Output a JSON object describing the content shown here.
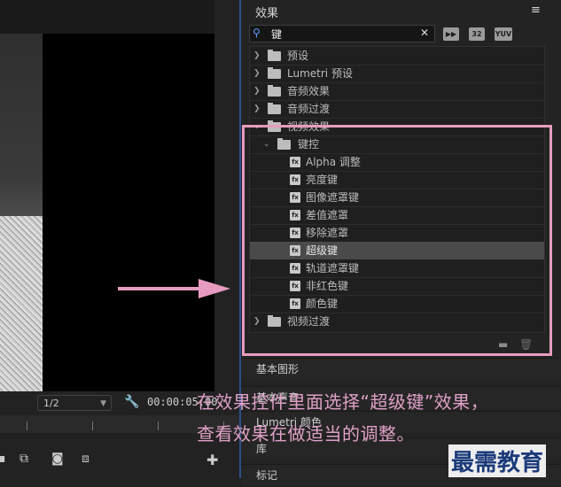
{
  "monitor": {
    "resolution": "1/2",
    "timecode": "00:00:05:00",
    "controls": [
      "step-back-icon",
      "insert-icon",
      "camera-icon",
      "compare-icon",
      "add-icon"
    ]
  },
  "effects_panel": {
    "title": "效果",
    "menu_icon": "hamburger-icon",
    "search_value": "键",
    "filter_buttons": [
      "accelerated-effects-icon",
      "32",
      "YUV"
    ],
    "tree": [
      {
        "label": "预设",
        "type": "folder",
        "level": 0,
        "expanded": false
      },
      {
        "label": "Lumetri 预设",
        "type": "folder",
        "level": 0,
        "expanded": false
      },
      {
        "label": "音频效果",
        "type": "folder",
        "level": 0,
        "expanded": false
      },
      {
        "label": "音频过渡",
        "type": "folder",
        "level": 0,
        "expanded": false
      },
      {
        "label": "视频效果",
        "type": "folder",
        "level": 0,
        "expanded": true
      },
      {
        "label": "键控",
        "type": "folder",
        "level": 1,
        "expanded": true
      },
      {
        "label": "Alpha 调整",
        "type": "effect",
        "level": 2
      },
      {
        "label": "亮度键",
        "type": "effect",
        "level": 2
      },
      {
        "label": "图像遮罩键",
        "type": "effect",
        "level": 2
      },
      {
        "label": "差值遮罩",
        "type": "effect",
        "level": 2
      },
      {
        "label": "移除遮罩",
        "type": "effect",
        "level": 2
      },
      {
        "label": "超级键",
        "type": "effect",
        "level": 2,
        "selected": true
      },
      {
        "label": "轨道遮罩键",
        "type": "effect",
        "level": 2
      },
      {
        "label": "非红色键",
        "type": "effect",
        "level": 2
      },
      {
        "label": "颜色键",
        "type": "effect",
        "level": 2
      },
      {
        "label": "视频过渡",
        "type": "folder",
        "level": 0,
        "expanded": false
      }
    ]
  },
  "panels": [
    {
      "label": "基本图形"
    },
    {
      "label": "基本声音"
    },
    {
      "label": "Lumetri 颜色"
    },
    {
      "label": "库"
    },
    {
      "label": "标记"
    }
  ],
  "annotation": {
    "line1": "在效果控件里面选择“超级键”效果，",
    "line2": "查看效果在做适当的调整。",
    "highlight_color": "#e79bc0"
  },
  "watermark": "最需教育"
}
